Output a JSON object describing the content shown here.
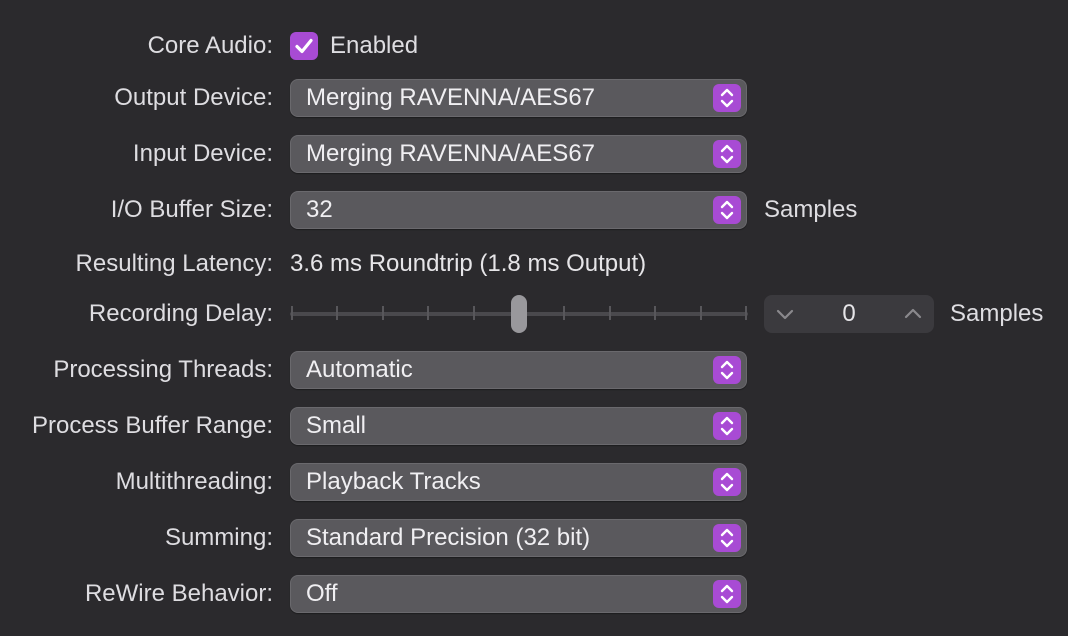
{
  "colors": {
    "background": "#2b2a2d",
    "accent": "#a84bd4",
    "popup_bg": "#5a595d"
  },
  "core_audio": {
    "label": "Core Audio:",
    "checkbox_label": "Enabled",
    "checked": true
  },
  "output_device": {
    "label": "Output Device:",
    "value": "Merging RAVENNA/AES67"
  },
  "input_device": {
    "label": "Input Device:",
    "value": "Merging RAVENNA/AES67"
  },
  "io_buffer_size": {
    "label": "I/O Buffer Size:",
    "value": "32",
    "unit": "Samples"
  },
  "resulting_latency": {
    "label": "Resulting Latency:",
    "value": "3.6 ms Roundtrip (1.8 ms Output)"
  },
  "recording_delay": {
    "label": "Recording Delay:",
    "value": "0",
    "unit": "Samples",
    "slider_fraction": 0.5,
    "tick_count": 11
  },
  "processing_threads": {
    "label": "Processing Threads:",
    "value": "Automatic"
  },
  "process_buffer_range": {
    "label": "Process Buffer Range:",
    "value": "Small"
  },
  "multithreading": {
    "label": "Multithreading:",
    "value": "Playback Tracks"
  },
  "summing": {
    "label": "Summing:",
    "value": "Standard Precision (32 bit)"
  },
  "rewire_behavior": {
    "label": "ReWire Behavior:",
    "value": "Off"
  }
}
